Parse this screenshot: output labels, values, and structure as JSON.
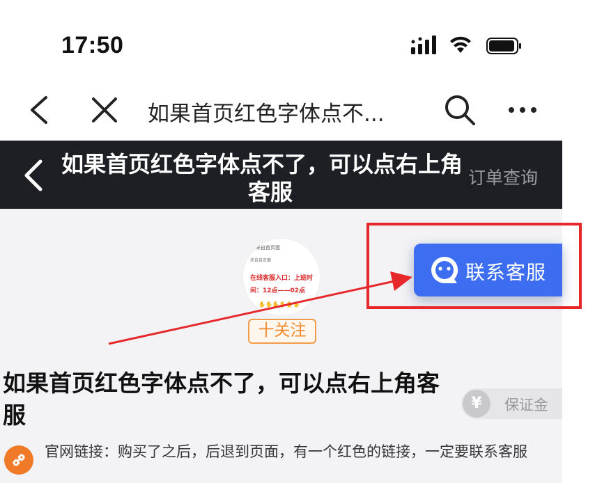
{
  "status_bar": {
    "time": "17:50"
  },
  "nav": {
    "title": "如果首页红色字体点不..."
  },
  "banner": {
    "title_line1": "如果首页红色字体点不了，可以点右上角",
    "title_line2": "客服",
    "order_query": "订单查询"
  },
  "shop": {
    "avatar_mini_top": "来自首页面",
    "avatar_mini_sub": "来自自页面",
    "avatar_mini_red": "在线客服入口：上班时间：12点——02点",
    "follow_label": "十关注"
  },
  "product": {
    "title": "如果首页红色字体点不了，可以点右上角客服",
    "deposit_symbol": "¥",
    "deposit_label": "保证金",
    "description": "官网链接：购买了之后，后退到页面，有一个红色的链接，一定要联系客服"
  },
  "customer_service": {
    "label": "联系客服"
  },
  "colors": {
    "accent_blue": "#3d6ef2",
    "annotation_red": "#e6282b",
    "follow_orange": "#f08a2e",
    "banner_dark": "#1e1f24"
  }
}
